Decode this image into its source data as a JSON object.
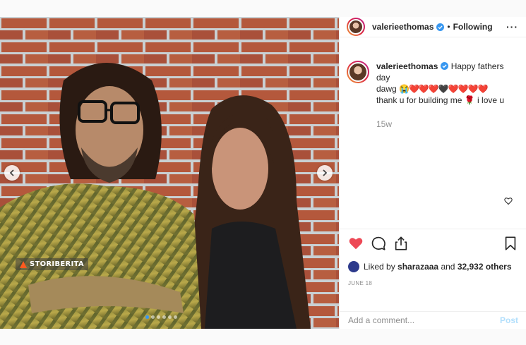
{
  "post": {
    "media": {
      "watermark_text": "STORIBERITA",
      "carousel": {
        "count": 6,
        "active_index": 0
      },
      "icons": {
        "prev": "chevron-left-icon",
        "next": "chevron-right-icon"
      }
    },
    "header": {
      "username": "valerieethomas",
      "verified": true,
      "separator": "•",
      "follow_status": "Following",
      "more_label": "···"
    },
    "caption": {
      "username": "valerieethomas",
      "text_line1": "Happy fathers day",
      "text_line2_word": "dawg",
      "emoji_hearts": "😭❤️❤️❤️🖤❤️❤️❤️❤️",
      "text_line3": "thank u for building me",
      "rose": "🌹",
      "text_end": "i love u",
      "time_ago": "15w"
    },
    "actions": {
      "like_icon": "heart-filled-icon",
      "comment_icon": "comment-icon",
      "share_icon": "share-icon",
      "save_icon": "bookmark-icon",
      "liked": true
    },
    "likes": {
      "prefix": "Liked by",
      "user": "sharazaaa",
      "middle": "and",
      "others": "32,932 others"
    },
    "date": "JUNE 18",
    "comment_input": {
      "placeholder": "Add a comment...",
      "value": "",
      "post_label": "Post"
    },
    "colors": {
      "like_red": "#ed4956",
      "verified_blue": "#3897f0",
      "post_disabled": "#b2dffc",
      "muted": "#8e8e8e"
    }
  }
}
